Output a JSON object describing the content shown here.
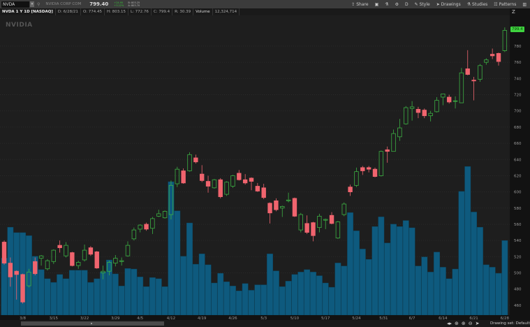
{
  "toolbar": {
    "symbol": "NVDA",
    "company": "NVIDIA CORP COM",
    "last": "799.40",
    "change": "+24.95",
    "change_pct": "+3.22%",
    "bid": "B: 803.25",
    "ask": "A: 803.70",
    "share": "Share",
    "style": "Style",
    "drawings": "Drawings",
    "studies": "Studies",
    "patterns": "Patterns",
    "d_label": "D"
  },
  "info": {
    "title": "NVDA 1 Y 1D [NASDAQ]",
    "date": "D: 6/28/21",
    "open": "O: 774.45",
    "high": "H: 803.15",
    "low": "L: 772.76",
    "close": "C: 799.4",
    "range": "R: 30.39",
    "volume_label": "Volume",
    "volume": "12,324,714"
  },
  "logo": "NVIDIA",
  "last_price_tag": "799.4",
  "bottom": {
    "drawing_set": "Drawing set: Default"
  },
  "colors": {
    "up": "#3cb043",
    "down": "#f0646e",
    "volume": "#0e5a7e",
    "last_tag": "#3fd43f"
  },
  "chart_data": {
    "type": "candlestick",
    "ylim": [
      450,
      810
    ],
    "yticks": [
      460,
      480,
      500,
      520,
      540,
      560,
      580,
      600,
      620,
      640,
      660,
      680,
      700,
      720,
      740,
      760,
      780
    ],
    "xticks": [
      "3/8",
      "3/15",
      "3/22",
      "3/29",
      "4/5",
      "4/12",
      "4/19",
      "4/26",
      "5/3",
      "5/10",
      "5/17",
      "5/24",
      "5/31",
      "6/7",
      "6/14",
      "6/21",
      "6/28"
    ],
    "dates": [
      "3/3",
      "3/4",
      "3/5",
      "3/8",
      "3/9",
      "3/10",
      "3/11",
      "3/12",
      "3/15",
      "3/16",
      "3/17",
      "3/18",
      "3/19",
      "3/22",
      "3/23",
      "3/24",
      "3/25",
      "3/26",
      "3/29",
      "3/30",
      "3/31",
      "4/1",
      "4/5",
      "4/6",
      "4/7",
      "4/8",
      "4/9",
      "4/12",
      "4/13",
      "4/14",
      "4/15",
      "4/16",
      "4/19",
      "4/20",
      "4/21",
      "4/22",
      "4/23",
      "4/26",
      "4/27",
      "4/28",
      "4/29",
      "4/30",
      "5/3",
      "5/4",
      "5/5",
      "5/6",
      "5/7",
      "5/10",
      "5/11",
      "5/12",
      "5/13",
      "5/14",
      "5/17",
      "5/18",
      "5/19",
      "5/20",
      "5/21",
      "5/24",
      "5/25",
      "5/26",
      "5/27",
      "5/28",
      "6/1",
      "6/2",
      "6/3",
      "6/4",
      "6/7",
      "6/8",
      "6/9",
      "6/10",
      "6/11",
      "6/14",
      "6/15",
      "6/16",
      "6/17",
      "6/18",
      "6/21",
      "6/22",
      "6/23",
      "6/24",
      "6/25",
      "6/28"
    ],
    "ohlc": [
      [
        538,
        540,
        510,
        512
      ],
      [
        512,
        519,
        483,
        495
      ],
      [
        502,
        503,
        467,
        498
      ],
      [
        498,
        499,
        462,
        464
      ],
      [
        484,
        505,
        482,
        501
      ],
      [
        514,
        519,
        497,
        499
      ],
      [
        518,
        522,
        509,
        521
      ],
      [
        505,
        517,
        503,
        515
      ],
      [
        514,
        529,
        511,
        528
      ],
      [
        534,
        540,
        525,
        531
      ],
      [
        521,
        538,
        519,
        534
      ],
      [
        525,
        526,
        508,
        509
      ],
      [
        509,
        515,
        505,
        513
      ],
      [
        516,
        535,
        514,
        528
      ],
      [
        531,
        533,
        521,
        523
      ],
      [
        526,
        527,
        505,
        506
      ],
      [
        500,
        509,
        492,
        502
      ],
      [
        502,
        515,
        497,
        513
      ],
      [
        512,
        522,
        508,
        518
      ],
      [
        514,
        519,
        509,
        515
      ],
      [
        521,
        539,
        520,
        534
      ],
      [
        542,
        556,
        540,
        553
      ],
      [
        554,
        560,
        550,
        559
      ],
      [
        560,
        562,
        552,
        554
      ],
      [
        555,
        569,
        548,
        567
      ],
      [
        570,
        578,
        569,
        573
      ],
      [
        568,
        577,
        567,
        576
      ],
      [
        572,
        614,
        566,
        608
      ],
      [
        610,
        631,
        606,
        628
      ],
      [
        626,
        629,
        610,
        611
      ],
      [
        626,
        649,
        625,
        646
      ],
      [
        642,
        646,
        635,
        637
      ],
      [
        622,
        633,
        612,
        614
      ],
      [
        613,
        620,
        599,
        607
      ],
      [
        605,
        616,
        604,
        615
      ],
      [
        615,
        617,
        592,
        594
      ],
      [
        597,
        613,
        595,
        612
      ],
      [
        607,
        621,
        605,
        620
      ],
      [
        623,
        627,
        614,
        615
      ],
      [
        615,
        622,
        609,
        611
      ],
      [
        617,
        618,
        602,
        613
      ],
      [
        607,
        611,
        600,
        601
      ],
      [
        605,
        610,
        591,
        593
      ],
      [
        586,
        587,
        561,
        574
      ],
      [
        589,
        592,
        576,
        578
      ],
      [
        580,
        583,
        569,
        582
      ],
      [
        589,
        599,
        587,
        590
      ],
      [
        592,
        593,
        569,
        570
      ],
      [
        553,
        574,
        550,
        572
      ],
      [
        561,
        571,
        548,
        550
      ],
      [
        562,
        563,
        539,
        546
      ],
      [
        556,
        573,
        550,
        570
      ],
      [
        565,
        567,
        554,
        566
      ],
      [
        571,
        575,
        560,
        561
      ],
      [
        543,
        564,
        542,
        563
      ],
      [
        572,
        587,
        570,
        585
      ],
      [
        606,
        609,
        595,
        600
      ],
      [
        608,
        630,
        606,
        625
      ],
      [
        630,
        632,
        621,
        626
      ],
      [
        630,
        632,
        624,
        628
      ],
      [
        628,
        630,
        618,
        619
      ],
      [
        620,
        651,
        619,
        650
      ],
      [
        652,
        656,
        636,
        650
      ],
      [
        650,
        677,
        650,
        672
      ],
      [
        668,
        690,
        663,
        679
      ],
      [
        684,
        706,
        683,
        704
      ],
      [
        703,
        712,
        688,
        705
      ],
      [
        702,
        705,
        691,
        698
      ],
      [
        701,
        703,
        691,
        694
      ],
      [
        694,
        700,
        687,
        697
      ],
      [
        699,
        717,
        698,
        713
      ],
      [
        717,
        721,
        707,
        721
      ],
      [
        717,
        720,
        709,
        711
      ],
      [
        712,
        718,
        703,
        712.5
      ],
      [
        710,
        753,
        710,
        747
      ],
      [
        752,
        775,
        744,
        745
      ],
      [
        738,
        742,
        713,
        737
      ],
      [
        739,
        758,
        736,
        756
      ],
      [
        760,
        765,
        757,
        763
      ],
      [
        770,
        777,
        764,
        768
      ],
      [
        771,
        772,
        756,
        761
      ],
      [
        774.45,
        803.15,
        772.76,
        799.4
      ]
    ],
    "volume_millions": [
      9.4,
      14.5,
      13.6,
      13.6,
      13.1,
      9.7,
      7.5,
      6.0,
      5.4,
      6.7,
      6.0,
      7.4,
      7.4,
      7.4,
      5.4,
      6.0,
      7.1,
      9.1,
      6.8,
      4.8,
      7.7,
      7.6,
      6.3,
      4.7,
      6.2,
      6.0,
      4.7,
      22.0,
      17.2,
      9.7,
      15.2,
      8.4,
      10.1,
      8.3,
      5.3,
      6.9,
      5.5,
      4.8,
      4.0,
      5.2,
      4.1,
      5.0,
      5.0,
      10.1,
      7.3,
      4.7,
      5.6,
      6.7,
      7.1,
      7.5,
      7.1,
      6.5,
      5.3,
      4.6,
      8.6,
      8.1,
      16.9,
      13.9,
      10.9,
      9.2,
      14.6,
      16.2,
      11.9,
      15.0,
      14.6,
      15.6,
      14.4,
      8.1,
      9.6,
      7.1,
      10.4,
      7.9,
      6.0,
      7.6,
      20.4,
      24.5,
      17.0,
      14.5,
      8.3,
      7.9,
      6.9,
      12.3
    ],
    "grid": true
  }
}
